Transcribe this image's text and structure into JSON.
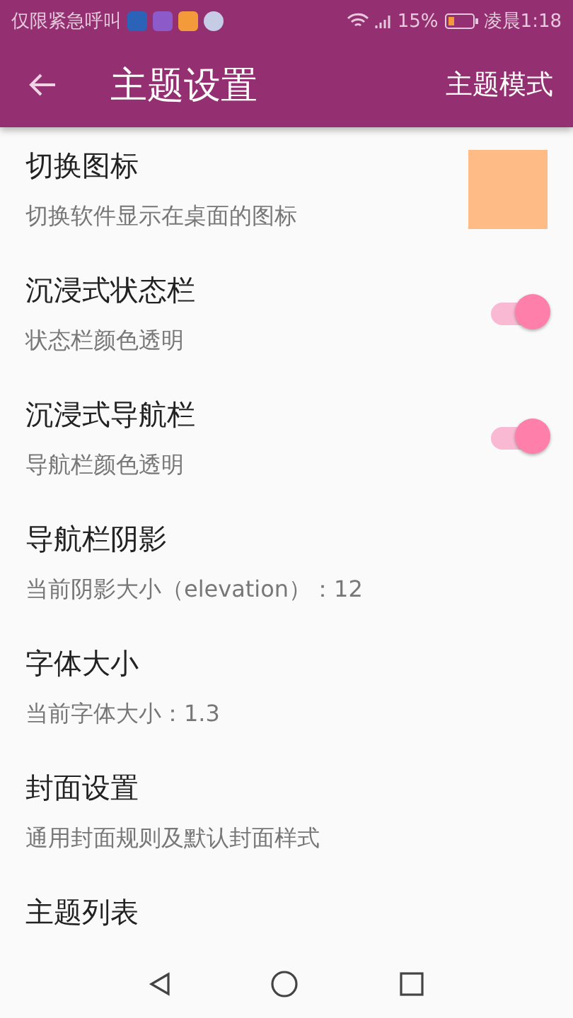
{
  "status_bar": {
    "carrier": "仅限紧急呼叫",
    "battery": "15%",
    "time": "凌晨1:18"
  },
  "app_bar": {
    "title": "主题设置",
    "action": "主题模式"
  },
  "settings": [
    {
      "kind": "swatch",
      "title": "切换图标",
      "subtitle": "切换软件显示在桌面的图标"
    },
    {
      "kind": "switch",
      "title": "沉浸式状态栏",
      "subtitle": "状态栏颜色透明",
      "on": true
    },
    {
      "kind": "switch",
      "title": "沉浸式导航栏",
      "subtitle": "导航栏颜色透明",
      "on": true
    },
    {
      "kind": "plain",
      "title": "导航栏阴影",
      "subtitle": "当前阴影大小（elevation）：12"
    },
    {
      "kind": "plain",
      "title": "字体大小",
      "subtitle": "当前字体大小：1.3"
    },
    {
      "kind": "plain",
      "title": "封面设置",
      "subtitle": "通用封面规则及默认封面样式"
    },
    {
      "kind": "plain",
      "title": "主题列表"
    }
  ]
}
